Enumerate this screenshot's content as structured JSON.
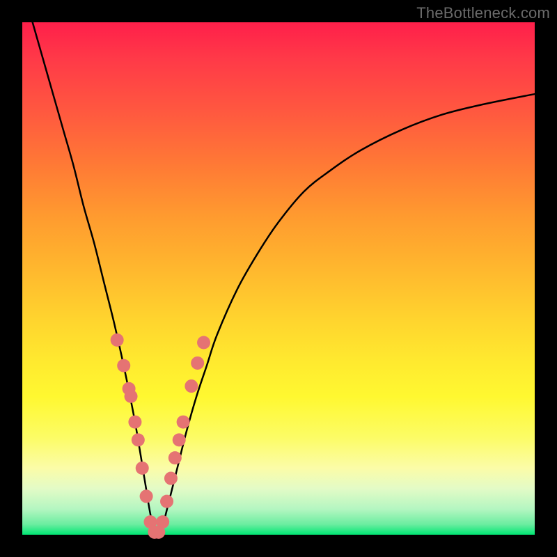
{
  "watermark": {
    "text": "TheBottleneck.com"
  },
  "chart_data": {
    "type": "line",
    "title": "",
    "xlabel": "",
    "ylabel": "",
    "xlim": [
      0,
      100
    ],
    "ylim": [
      0,
      100
    ],
    "grid": false,
    "series": [
      {
        "name": "bottleneck-curve",
        "color": "#000000",
        "x": [
          2,
          4,
          6,
          8,
          10,
          12,
          14,
          16,
          18,
          20,
          22,
          24,
          25,
          26,
          27,
          28,
          30,
          32,
          34,
          36,
          38,
          42,
          46,
          50,
          55,
          60,
          66,
          74,
          82,
          90,
          100
        ],
        "values": [
          100,
          93,
          86,
          79,
          72,
          64,
          57,
          49,
          41,
          32,
          22,
          10,
          4,
          0,
          0,
          4,
          12,
          20,
          27,
          33,
          39,
          48,
          55,
          61,
          67,
          71,
          75,
          79,
          82,
          84,
          86
        ]
      }
    ],
    "marker_points": {
      "name": "highlight-dots",
      "color": "#e57373",
      "x": [
        18.5,
        19.8,
        20.8,
        21.2,
        22.0,
        22.6,
        23.4,
        24.2,
        25.0,
        25.8,
        26.6,
        27.4,
        28.2,
        29.0,
        29.8,
        30.6,
        31.4,
        33.0,
        34.2,
        35.4
      ],
      "values": [
        38.0,
        33.0,
        28.5,
        27.0,
        22.0,
        18.5,
        13.0,
        7.5,
        2.5,
        0.5,
        0.5,
        2.5,
        6.5,
        11.0,
        15.0,
        18.5,
        22.0,
        29.0,
        33.5,
        37.5
      ]
    },
    "gradient_stops": [
      {
        "pos": 0.0,
        "color": "#ff1f4a"
      },
      {
        "pos": 0.38,
        "color": "#ff9b2f"
      },
      {
        "pos": 0.66,
        "color": "#ffe92f"
      },
      {
        "pos": 0.87,
        "color": "#fbfca8"
      },
      {
        "pos": 1.0,
        "color": "#00e673"
      }
    ]
  }
}
